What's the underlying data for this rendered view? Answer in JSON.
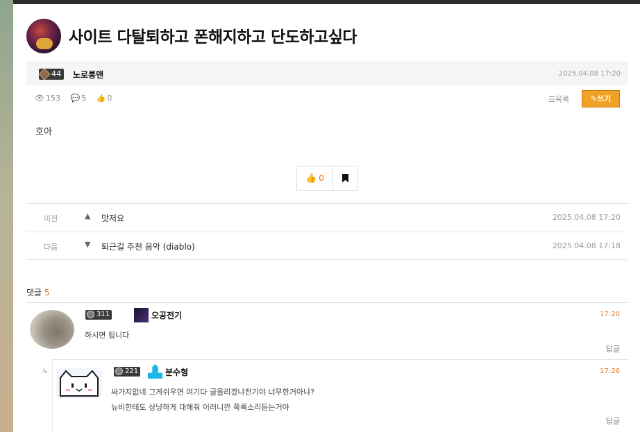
{
  "post": {
    "title": "사이트 다탈퇴하고 폰해지하고 단도하고싶다",
    "author": {
      "level": "44",
      "name": "노로롱맨"
    },
    "date": "2025.04.08 17:20",
    "stats": {
      "views": "153",
      "comments": "5",
      "likes": "0"
    },
    "body": "호아"
  },
  "actions": {
    "list_label": "목록",
    "write_label": "쓰기",
    "like_count": "0"
  },
  "navigation": {
    "prev": {
      "label": "이전",
      "title": "맛저요",
      "date": "2025.04.08 17:20"
    },
    "next": {
      "label": "다음",
      "title": "퇴근길 추천 음악 (diablo)",
      "date": "2025.04.08 17:18"
    }
  },
  "comments": {
    "header_label": "댓글",
    "count": "5",
    "items": [
      {
        "level": "311",
        "name": "오공전기",
        "time": "17:20",
        "lines": [
          "하시면 됩니다"
        ],
        "reply_label": "답글"
      },
      {
        "level": "221",
        "name": "분수형",
        "time": "17:26",
        "lines": [
          "싸가지없네 그게쉬우면 여기다 글올리겠냐전기야 너무한거아냐?",
          "뉴비한테도 상냥하게 대해줘 이러니깐 쭉록소리듣는거야"
        ],
        "reply_label": "답글"
      }
    ]
  },
  "colors": {
    "accent": "#f0a226",
    "highlight": "#e07a2c",
    "topbar": "#2d2d2d"
  }
}
